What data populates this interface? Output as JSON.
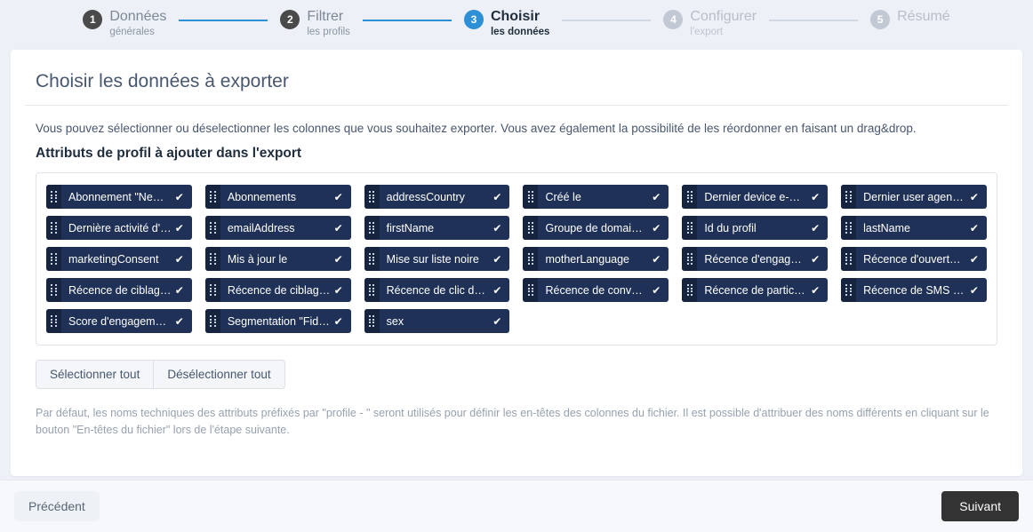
{
  "stepper": {
    "steps": [
      {
        "number": "1",
        "title": "Données",
        "subtitle": "générales",
        "state": "done"
      },
      {
        "number": "2",
        "title": "Filtrer",
        "subtitle": "les profils",
        "state": "done"
      },
      {
        "number": "3",
        "title": "Choisir",
        "subtitle": "les données",
        "state": "active"
      },
      {
        "number": "4",
        "title": "Configurer",
        "subtitle": "l'export",
        "state": "todo"
      },
      {
        "number": "5",
        "title": "Résumé",
        "subtitle": "",
        "state": "todo"
      }
    ]
  },
  "card": {
    "title": "Choisir les données à exporter",
    "intro": "Vous pouvez sélectionner ou déselectionner les colonnes que vous souhaitez exporter. Vous avez également la possibilité de les réordonner en faisant un drag&drop.",
    "section_title": "Attributs de profil à ajouter dans l'export",
    "footnote": "Par défaut, les noms techniques des attributs préfixés par \"profile - \" seront utilisés pour définir les en-têtes des colonnes du fichier. Il est possible d'attribuer des noms différents en cliquant sur le bouton \"En-têtes du fichier\" lors de l'étape suivante."
  },
  "attributes": [
    {
      "label": "Abonnement \"Newsl...",
      "selected": true
    },
    {
      "label": "Abonnements",
      "selected": true
    },
    {
      "label": "addressCountry",
      "selected": true
    },
    {
      "label": "Créé le",
      "selected": true
    },
    {
      "label": "Dernier device e-mail",
      "selected": true
    },
    {
      "label": "Dernier user agent e...",
      "selected": true
    },
    {
      "label": "Dernière activité d'u...",
      "selected": true
    },
    {
      "label": "emailAddress",
      "selected": true
    },
    {
      "label": "firstName",
      "selected": true
    },
    {
      "label": "Groupe de domaine ...",
      "selected": true
    },
    {
      "label": "Id du profil",
      "selected": true
    },
    {
      "label": "lastName",
      "selected": true
    },
    {
      "label": "marketingConsent",
      "selected": true
    },
    {
      "label": "Mis à jour le",
      "selected": true
    },
    {
      "label": "Mise sur liste noire",
      "selected": true
    },
    {
      "label": "motherLanguage",
      "selected": true
    },
    {
      "label": "Récence d'engagem...",
      "selected": true
    },
    {
      "label": "Récence d'ouverture...",
      "selected": true
    },
    {
      "label": "Récence de ciblage ...",
      "selected": true
    },
    {
      "label": "Récence de ciblage S...",
      "selected": true
    },
    {
      "label": "Récence de clic dans...",
      "selected": true
    },
    {
      "label": "Récence de conversi...",
      "selected": true
    },
    {
      "label": "Récence de participa...",
      "selected": true
    },
    {
      "label": "Récence de SMS reçu",
      "selected": true
    },
    {
      "label": "Score d'engagement...",
      "selected": true
    },
    {
      "label": "Segmentation \"Fideli...",
      "selected": true
    },
    {
      "label": "sex",
      "selected": true
    }
  ],
  "buttons": {
    "select_all": "Sélectionner tout",
    "deselect_all": "Désélectionner tout",
    "previous": "Précédent",
    "next": "Suivant"
  },
  "icons": {
    "drag_handle": "drag-handle-icon",
    "check": "✔"
  },
  "colors": {
    "accent": "#2d8fd5",
    "chip_bg": "#1f3157",
    "chip_handle_bg": "#16243f",
    "next_button_bg": "#333333",
    "page_bg": "#edf1f7"
  }
}
